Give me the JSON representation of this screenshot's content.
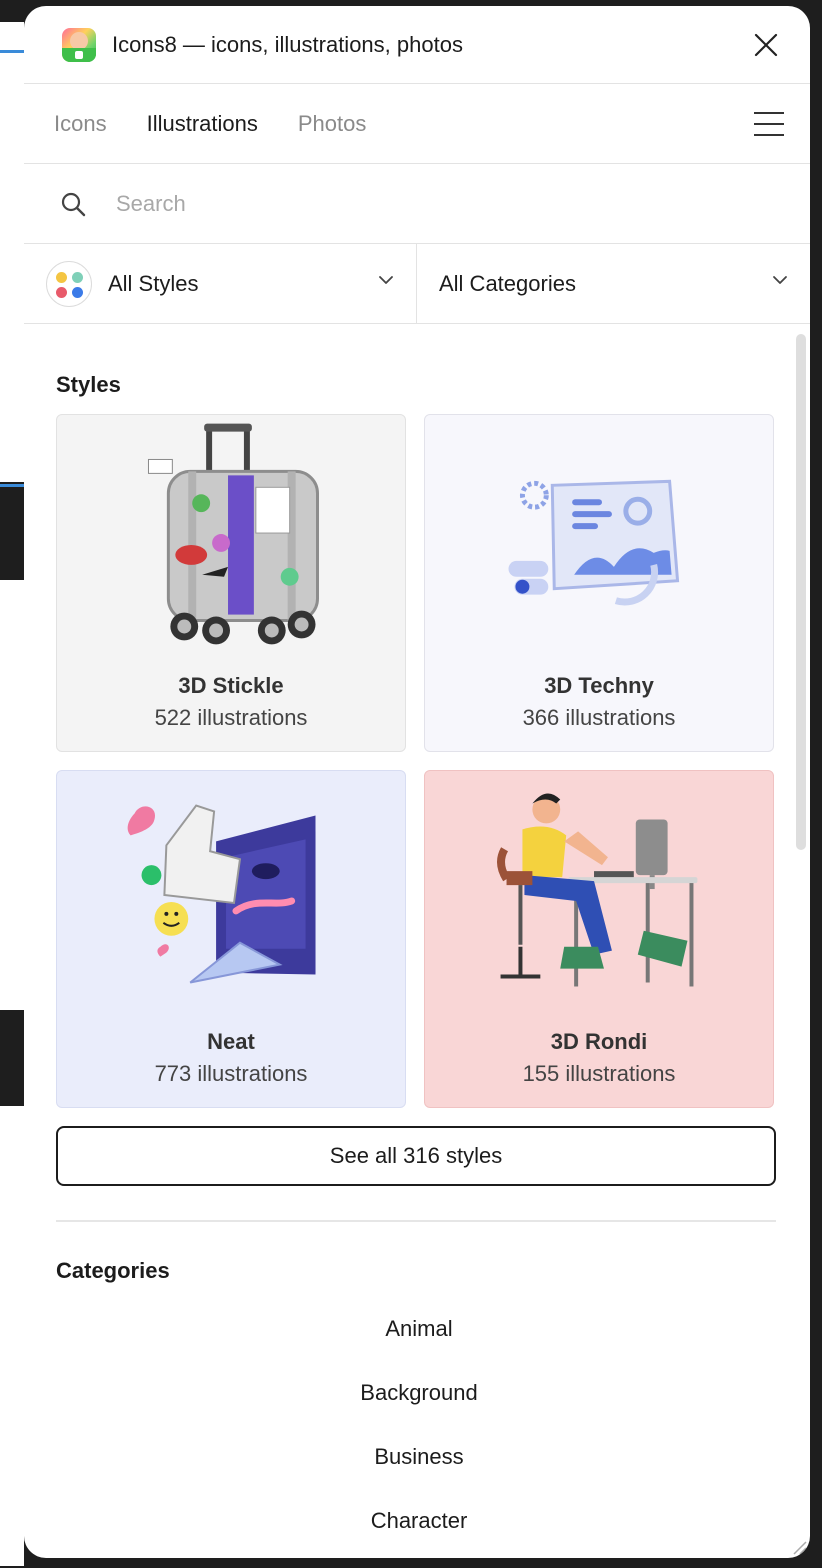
{
  "window": {
    "title": "Icons8 — icons, illustrations, photos"
  },
  "tabs": [
    {
      "label": "Icons",
      "active": false
    },
    {
      "label": "Illustrations",
      "active": true
    },
    {
      "label": "Photos",
      "active": false
    }
  ],
  "search": {
    "placeholder": "Search",
    "value": ""
  },
  "filters": {
    "styles_label": "All Styles",
    "categories_label": "All Categories"
  },
  "styles_section": {
    "title": "Styles",
    "cards": [
      {
        "name": "3D Stickle",
        "count": "522 illustrations",
        "bg": "#f4f4f4"
      },
      {
        "name": "3D Techny",
        "count": "366 illustrations",
        "bg": "#f7f7fc"
      },
      {
        "name": "Neat",
        "count": "773 illustrations",
        "bg": "#eaedfb"
      },
      {
        "name": "3D Rondi",
        "count": "155 illustrations",
        "bg": "#f9d6d6"
      }
    ],
    "see_all_label": "See all 316 styles"
  },
  "categories_section": {
    "title": "Categories",
    "items": [
      "Animal",
      "Background",
      "Business",
      "Character"
    ]
  },
  "colors": {
    "dot_yellow": "#f4c542",
    "dot_teal": "#7fd0b8",
    "dot_red": "#e85a6a",
    "dot_blue": "#3b7be8"
  }
}
